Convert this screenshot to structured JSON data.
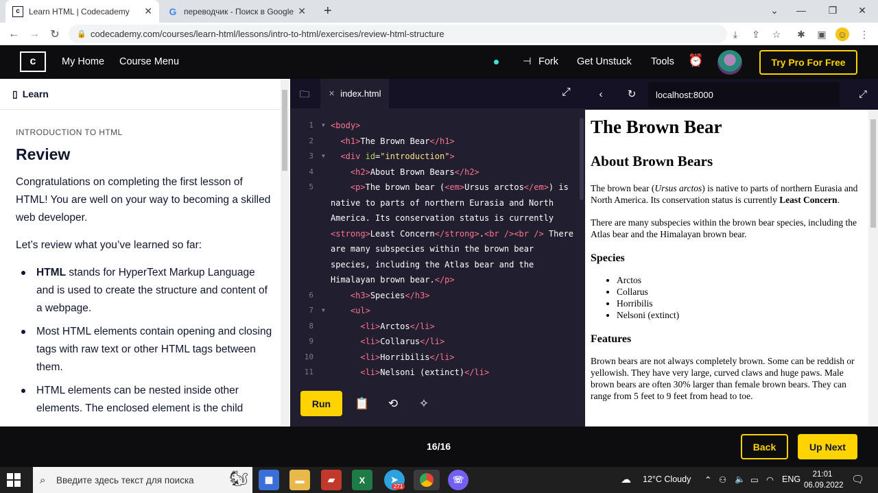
{
  "browser": {
    "tabs": [
      {
        "title": "Learn HTML | Codecademy",
        "favicon": "codecademy-favicon"
      },
      {
        "title": "переводчик - Поиск в Google",
        "favicon": "google-favicon"
      }
    ],
    "new_tab": "+",
    "url": "codecademy.com/courses/learn-html/lessons/intro-to-html/exercises/review-html-structure"
  },
  "nav": {
    "logo": "c",
    "my_home": "My Home",
    "course_menu": "Course Menu",
    "fork": "Fork",
    "get_unstuck": "Get Unstuck",
    "tools": "Tools",
    "try_pro": "Try Pro For Free"
  },
  "lesson": {
    "panel_title": "Learn",
    "kicker": "INTRODUCTION TO HTML",
    "title": "Review",
    "para1": "Congratulations on completing the first lesson of HTML! You are well on your way to becoming a skilled web developer.",
    "para2": "Let’s review what you’ve learned so far:",
    "bullet1_rest": "stands for HyperText Markup Language and is used to create the structure and content of a webpage.",
    "bullet1_bold": "HTML",
    "bullet2": "Most HTML elements contain opening and closing tags with raw text or other HTML tags between them.",
    "bullet3": "HTML elements can be nested inside other elements. The enclosed element is the child"
  },
  "editor": {
    "file_tab": "index.html",
    "line_numbers": [
      "1",
      "2",
      "3",
      "4",
      "5",
      "",
      "",
      "",
      "",
      "",
      "",
      "6",
      "7",
      "8",
      "9",
      "10",
      "11"
    ],
    "run": "Run"
  },
  "preview": {
    "url": "localhost:8000",
    "h1": "The Brown Bear",
    "h2": "About Brown Bears",
    "p1_a": "The brown bear (",
    "p1_em": "Ursus arctos",
    "p1_b": ") is native to parts of northern Eurasia and North America. Its conservation status is currently ",
    "p1_strong": "Least Concern",
    "p1_c": ".",
    "p2": "There are many subspecies within the brown bear species, including the Atlas bear and the Himalayan brown bear.",
    "h3_species": "Species",
    "species": [
      "Arctos",
      "Collarus",
      "Horribilis",
      "Nelsoni (extinct)"
    ],
    "h3_features": "Features",
    "p3": "Brown bears are not always completely brown. Some can be reddish or yellowish. They have very large, curved claws and huge paws. Male brown bears are often 30% larger than female brown bears. They can range from 5 feet to 9 feet from head to toe."
  },
  "footer": {
    "progress": "16/16",
    "back": "Back",
    "up_next": "Up Next"
  },
  "taskbar": {
    "search_placeholder": "Введите здесь текст для поиска",
    "weather": "12°C Cloudy",
    "lang": "ENG",
    "time": "21:01",
    "date": "06.09.2022",
    "telegram_badge": "271"
  }
}
